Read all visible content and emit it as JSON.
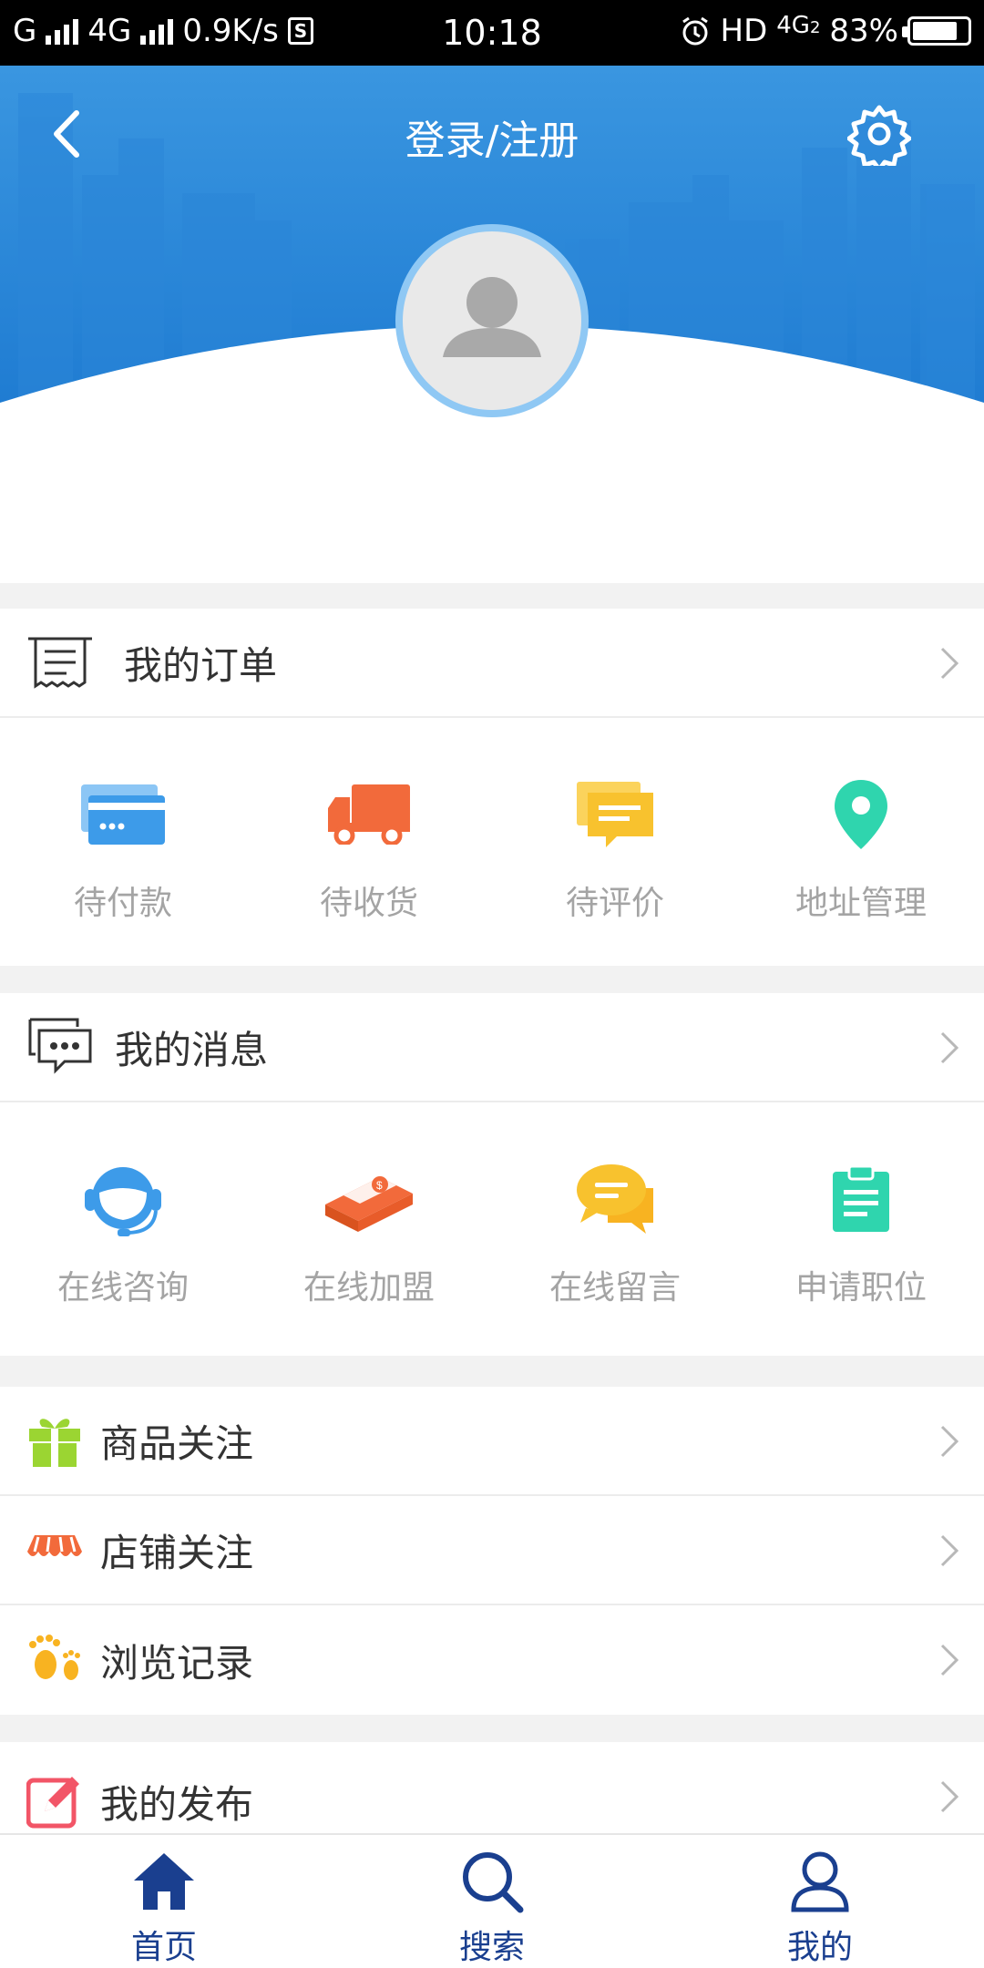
{
  "status_bar": {
    "carrier1": "G",
    "net_type": "4G",
    "speed": "0.9K/s",
    "sim_badge": "S",
    "time": "10:18",
    "hd_label": "HD",
    "net_type_right": "4G",
    "net_sub": "2",
    "battery": "83%"
  },
  "header": {
    "title": "登录/注册",
    "back_icon": "chevron-left-icon",
    "settings_icon": "gear-icon",
    "avatar_icon": "user-silhouette-icon",
    "gradient_top": "#3a96e0",
    "gradient_bottom": "#1d7ad1"
  },
  "orders": {
    "title": "我的订单",
    "icon": "receipt-icon",
    "items": [
      {
        "label": "待付款",
        "icon": "card-icon",
        "color": "#3d9be9"
      },
      {
        "label": "待收货",
        "icon": "truck-icon",
        "color": "#f26a3b"
      },
      {
        "label": "待评价",
        "icon": "comment-icon",
        "color": "#f8c22e"
      },
      {
        "label": "地址管理",
        "icon": "location-pin-icon",
        "color": "#2fd5ae"
      }
    ]
  },
  "messages": {
    "title": "我的消息",
    "icon": "chat-bubbles-icon",
    "items": [
      {
        "label": "在线咨询",
        "icon": "headset-icon",
        "color": "#3d9be9"
      },
      {
        "label": "在线加盟",
        "icon": "money-stack-icon",
        "color": "#f26a3b"
      },
      {
        "label": "在线留言",
        "icon": "message-icon",
        "color": "#f8c22e"
      },
      {
        "label": "申请职位",
        "icon": "clipboard-icon",
        "color": "#2fd5ae"
      }
    ]
  },
  "list": [
    {
      "label": "商品关注",
      "icon": "gift-icon",
      "color": "#9bd532"
    },
    {
      "label": "店铺关注",
      "icon": "shop-awning-icon",
      "color": "#f26a3b"
    },
    {
      "label": "浏览记录",
      "icon": "footprints-icon",
      "color": "#f8b321"
    },
    {
      "label": "我的发布",
      "icon": "edit-icon",
      "color": "#f25567"
    }
  ],
  "tabbar": {
    "tabs": [
      {
        "label": "首页",
        "icon": "home-icon"
      },
      {
        "label": "搜索",
        "icon": "search-icon"
      },
      {
        "label": "我的",
        "icon": "user-icon"
      }
    ],
    "color": "#1a3f8f"
  }
}
